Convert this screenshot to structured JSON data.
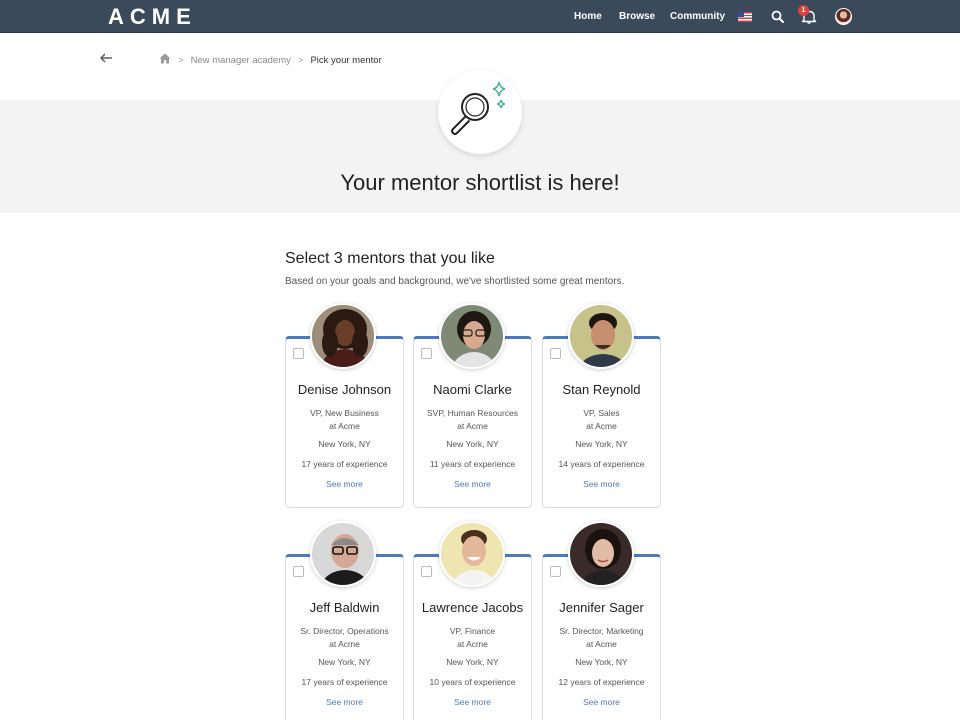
{
  "header": {
    "logo": "ACME",
    "nav": [
      "Home",
      "Browse",
      "Community"
    ],
    "notification_count": "1"
  },
  "breadcrumb": {
    "items": [
      "New manager academy",
      "Pick your mentor"
    ]
  },
  "hero": {
    "title": "Your mentor shortlist is here!"
  },
  "section": {
    "title": "Select 3 mentors that you like",
    "subtitle": "Based on your goals and background, we've shortlisted some great mentors."
  },
  "mentors": [
    {
      "name": "Denise Johnson",
      "role_line1": "VP, New Business",
      "role_line2": "at Acme",
      "location": "New York, NY",
      "experience": "17 years of experience",
      "see_more": "See more"
    },
    {
      "name": "Naomi Clarke",
      "role_line1": "SVP, Human Resources",
      "role_line2": "at Acme",
      "location": "New York, NY",
      "experience": "11 years of experience",
      "see_more": "See more"
    },
    {
      "name": "Stan Reynold",
      "role_line1": "VP, Sales",
      "role_line2": "at Acme",
      "location": "New York, NY",
      "experience": "14 years of experience",
      "see_more": "See more"
    },
    {
      "name": "Jeff Baldwin",
      "role_line1": "Sr. Director, Operations",
      "role_line2": "at Acme",
      "location": "New York, NY",
      "experience": "17 years of experience",
      "see_more": "See more"
    },
    {
      "name": "Lawrence Jacobs",
      "role_line1": "VP, Finance",
      "role_line2": "at Acme",
      "location": "New York, NY",
      "experience": "10 years of experience",
      "see_more": "See more"
    },
    {
      "name": "Jennifer Sager",
      "role_line1": "Sr. Director, Marketing",
      "role_line2": "at Acme",
      "location": "New York, NY",
      "experience": "12 years of experience",
      "see_more": "See more"
    }
  ],
  "colors": {
    "topbar": "#3a4a5b",
    "accent": "#4a7abf",
    "hero_bg": "#f3f3f3",
    "sparkle": "#3bb08f"
  }
}
